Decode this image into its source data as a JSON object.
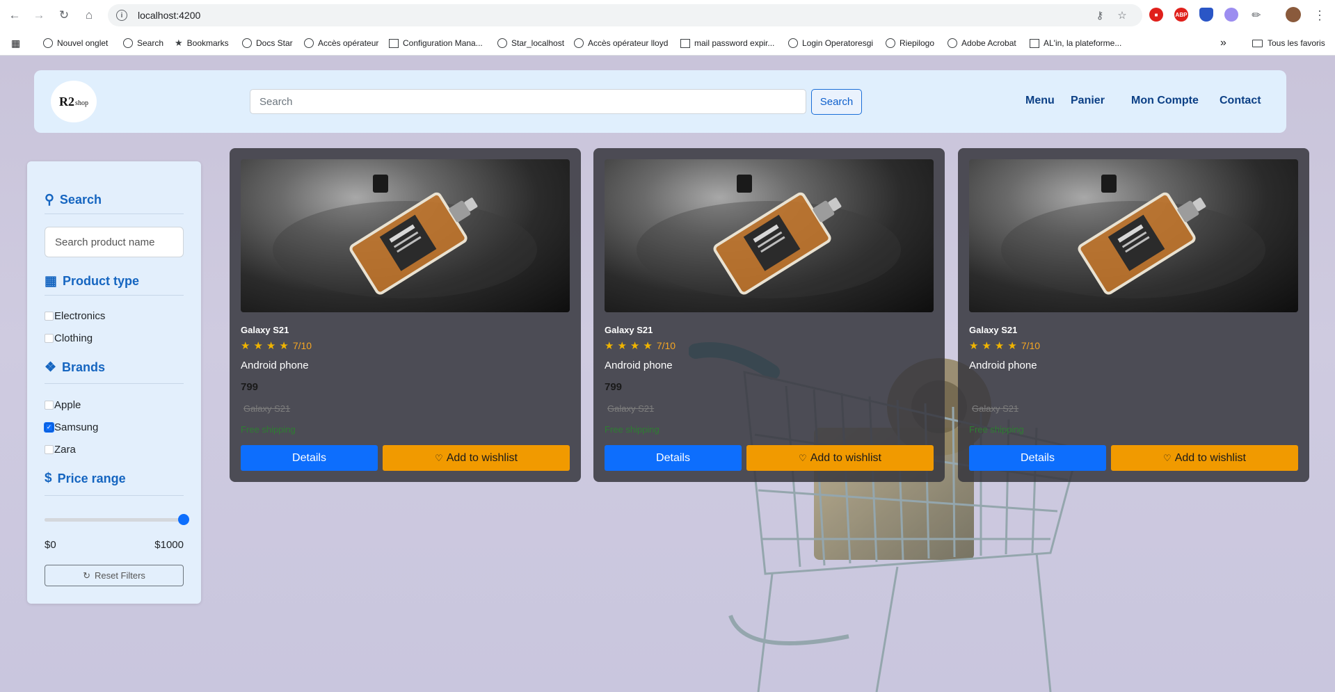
{
  "browser": {
    "url": "localhost:4200",
    "bookmarks": [
      {
        "label": "Nouvel onglet",
        "icon": "globe-icon"
      },
      {
        "label": "Search",
        "icon": "globe-icon"
      },
      {
        "label": "Bookmarks",
        "icon": "star-icon"
      },
      {
        "label": "Docs Star",
        "icon": "globe-icon"
      },
      {
        "label": "Accès opérateur",
        "icon": "globe-icon"
      },
      {
        "label": "Configuration Mana...",
        "icon": "page-icon"
      },
      {
        "label": "Star_localhost",
        "icon": "globe-icon"
      },
      {
        "label": "Accès opérateur lloyd",
        "icon": "globe-icon"
      },
      {
        "label": "mail password expir...",
        "icon": "app-icon"
      },
      {
        "label": "Login Operatoresgi",
        "icon": "globe-icon"
      },
      {
        "label": "Riepilogo",
        "icon": "globe-icon"
      },
      {
        "label": "Adobe Acrobat",
        "icon": "globe-icon"
      },
      {
        "label": "AL'in, la plateforme...",
        "icon": "app-icon"
      }
    ],
    "all_bookmarks_label": "Tous les favoris",
    "ext_abp_label": "ABP"
  },
  "navbar": {
    "logo_text": "R2",
    "logo_sub": "shop",
    "search_placeholder": "Search",
    "search_button": "Search",
    "links": [
      "Menu",
      "Panier",
      "Mon Compte",
      "Contact"
    ]
  },
  "sidebar": {
    "search_title": "Search",
    "search_placeholder": "Search product name",
    "product_type_title": "Product type",
    "product_types": [
      {
        "label": "Electronics",
        "checked": false
      },
      {
        "label": "Clothing",
        "checked": false
      }
    ],
    "brands_title": "Brands",
    "brands": [
      {
        "label": "Apple",
        "checked": false
      },
      {
        "label": "Samsung",
        "checked": true
      },
      {
        "label": "Zara",
        "checked": false
      }
    ],
    "price_title": "Price range",
    "price_min_label": "$0",
    "price_max_label": "$1000",
    "price_value_fraction": 1.0,
    "reset_label": "Reset Filters"
  },
  "products": [
    {
      "name": "Galaxy S21",
      "rating": "7/10",
      "stars": 4,
      "description": "Android phone",
      "price": "799",
      "old_name": "Galaxy S21",
      "shipping": "Free shipping",
      "details_label": "Details",
      "wishlist_label": "Add to wishlist"
    },
    {
      "name": "Galaxy S21",
      "rating": "7/10",
      "stars": 4,
      "description": "Android phone",
      "price": "799",
      "old_name": "Galaxy S21",
      "shipping": "Free shipping",
      "details_label": "Details",
      "wishlist_label": "Add to wishlist"
    },
    {
      "name": "Galaxy S21",
      "rating": "7/10",
      "stars": 4,
      "description": "Android phone",
      "price": "",
      "old_name": "Galaxy S21",
      "shipping": "Free shipping",
      "details_label": "Details",
      "wishlist_label": "Add to wishlist"
    }
  ],
  "colors": {
    "primary": "#0d6efd",
    "accent": "#f19a00",
    "heading": "#1565c0",
    "nav_link": "#0b3f85"
  }
}
